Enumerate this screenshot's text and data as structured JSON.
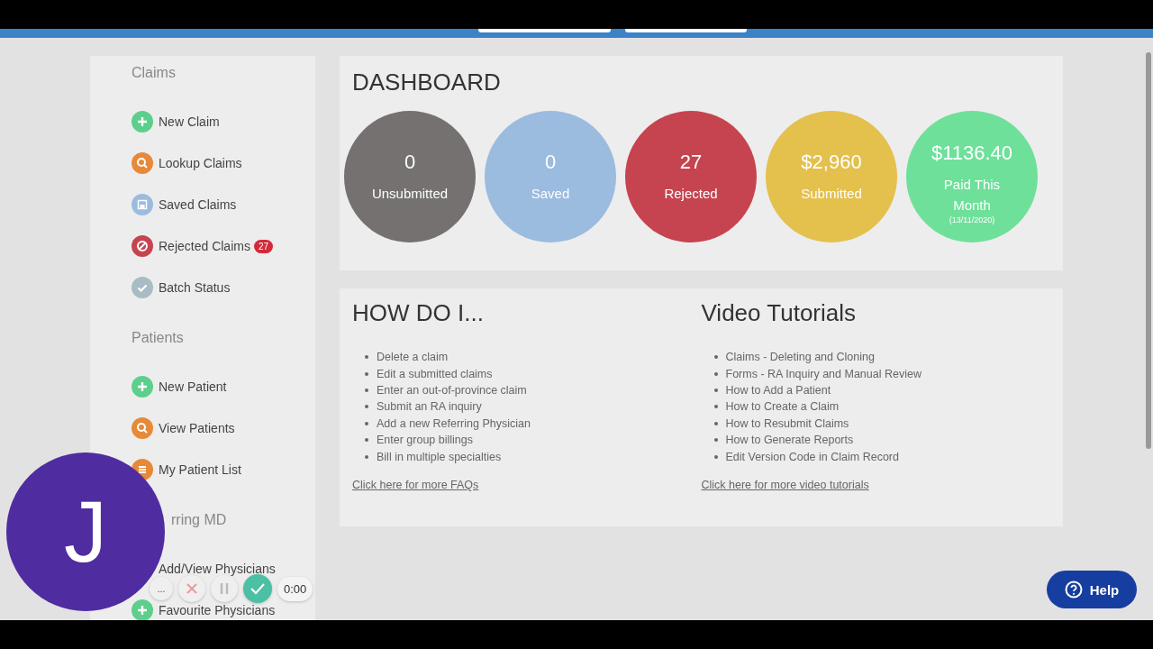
{
  "sidebar": {
    "sections": [
      {
        "title": "Claims",
        "items": [
          {
            "label": "New Claim",
            "kind": "plus"
          },
          {
            "label": "Lookup Claims",
            "kind": "search"
          },
          {
            "label": "Saved Claims",
            "kind": "save"
          },
          {
            "label": "Rejected Claims",
            "kind": "block",
            "badge": "27"
          },
          {
            "label": "Batch Status",
            "kind": "check"
          }
        ]
      },
      {
        "title": "Patients",
        "items": [
          {
            "label": "New Patient",
            "kind": "plus"
          },
          {
            "label": "View Patients",
            "kind": "search"
          },
          {
            "label": "My Patient List",
            "kind": "list"
          }
        ]
      },
      {
        "title": "rring MD",
        "items": [
          {
            "label": "Add/View Physicians",
            "kind": "hidden"
          },
          {
            "label": "Favourite Physicians",
            "kind": "plus"
          }
        ]
      }
    ]
  },
  "dashboard": {
    "title": "DASHBOARD",
    "stats": [
      {
        "value": "0",
        "label": "Unsubmitted",
        "color": "#747170"
      },
      {
        "value": "0",
        "label": "Saved",
        "color": "#9bbbdf"
      },
      {
        "value": "27",
        "label": "Rejected",
        "color": "#c6444f"
      },
      {
        "value": "$2,960",
        "label": "Submitted",
        "color": "#e4c04d"
      },
      {
        "value": "$1136.40",
        "label": "Paid This Month",
        "note": "(13/11/2020)",
        "color": "#6ee09a"
      }
    ]
  },
  "how_do_i": {
    "title": "HOW DO I...",
    "items": [
      "Delete a claim",
      "Edit a submitted claims",
      "Enter an out-of-province claim",
      "Submit an RA inquiry",
      "Add a new Referring Physician",
      "Enter group billings",
      "Bill in multiple specialties"
    ],
    "link": "Click here for more FAQs"
  },
  "video_tutorials": {
    "title": "Video Tutorials",
    "items": [
      "Claims - Deleting and Cloning",
      "Forms - RA Inquiry and Manual Review",
      "How to Add a Patient",
      "How to Create a Claim",
      "How to Resubmit Claims",
      "How to Generate Reports",
      "Edit Version Code in Claim Record"
    ],
    "link": "Click here for more video tutorials"
  },
  "recorder": {
    "avatar": "J",
    "more": "...",
    "timer": "0:00"
  },
  "help_button": {
    "label": "Help"
  }
}
